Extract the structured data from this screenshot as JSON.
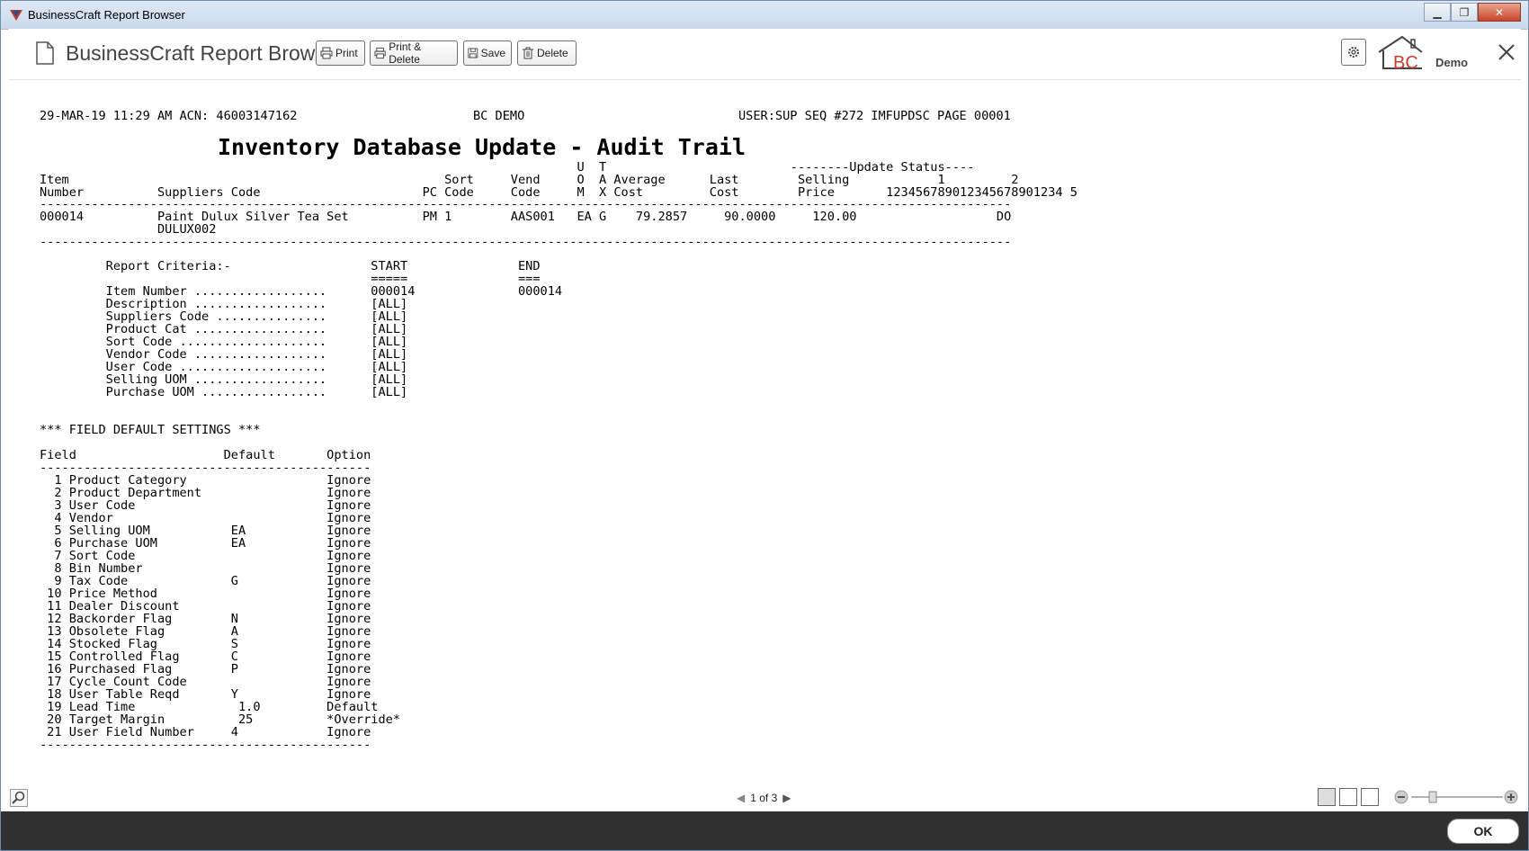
{
  "window": {
    "title": "BusinessCraft Report Browser"
  },
  "toolbar": {
    "app_title": "BusinessCraft Report Browser",
    "print": "Print",
    "print_delete": "Print & Delete",
    "save": "Save",
    "delete": "Delete",
    "brand": "BC",
    "demo": "Demo"
  },
  "report": {
    "header_left": "29-MAR-19 11:29 AM ACN: 46003147162",
    "header_center": "BC DEMO",
    "header_right": "USER:SUP SEQ #272 IMFUPDSC PAGE 00001",
    "title": "Inventory Database Update - Audit Trail",
    "col_lines": [
      "                                                                         U  T                         --------Update Status----",
      "Item                                                   Sort     Vend     O  A Average      Last        Selling            1         2",
      "Number          Suppliers Code                      PC Code     Code     M  X Cost         Cost        Price       123456789012345678901234 5"
    ],
    "sep1": "------------------------------------------------------------------------------------------------------------------------------------",
    "row_lines": [
      "000014          Paint Dulux Silver Tea Set          PM 1        AAS001   EA G    79.2857     90.0000     120.00                   DO",
      "                DULUX002"
    ],
    "sep2": "------------------------------------------------------------------------------------------------------------------------------------",
    "criteria_lines": [
      "         Report Criteria:-                   START               END",
      "                                             =====               ===",
      "         Item Number ..................      000014              000014",
      "         Description ..................      [ALL]",
      "         Suppliers Code ...............      [ALL]",
      "         Product Cat ..................      [ALL]",
      "         Sort Code ....................      [ALL]",
      "         Vendor Code ..................      [ALL]",
      "         User Code ....................      [ALL]",
      "         Selling UOM ..................      [ALL]",
      "         Purchase UOM .................      [ALL]"
    ],
    "field_defaults_lines": [
      "*** FIELD DEFAULT SETTINGS ***",
      "",
      "Field                    Default       Option",
      "---------------------------------------------",
      "  1 Product Category                   Ignore",
      "  2 Product Department                 Ignore",
      "  3 User Code                          Ignore",
      "  4 Vendor                             Ignore",
      "  5 Selling UOM           EA           Ignore",
      "  6 Purchase UOM          EA           Ignore",
      "  7 Sort Code                          Ignore",
      "  8 Bin Number                         Ignore",
      "  9 Tax Code              G            Ignore",
      " 10 Price Method                       Ignore",
      " 11 Dealer Discount                    Ignore",
      " 12 Backorder Flag        N            Ignore",
      " 13 Obsolete Flag         A            Ignore",
      " 14 Stocked Flag          S            Ignore",
      " 15 Controlled Flag       C            Ignore",
      " 16 Purchased Flag        P            Ignore",
      " 17 Cycle Count Code                   Ignore",
      " 18 User Table Reqd       Y            Ignore",
      " 19 Lead Time              1.0         Default",
      " 20 Target Margin          25          *Override*",
      " 21 User Field Number     4            Ignore",
      "---------------------------------------------"
    ]
  },
  "status": {
    "page": "1 of 3"
  },
  "footer": {
    "ok": "OK"
  }
}
